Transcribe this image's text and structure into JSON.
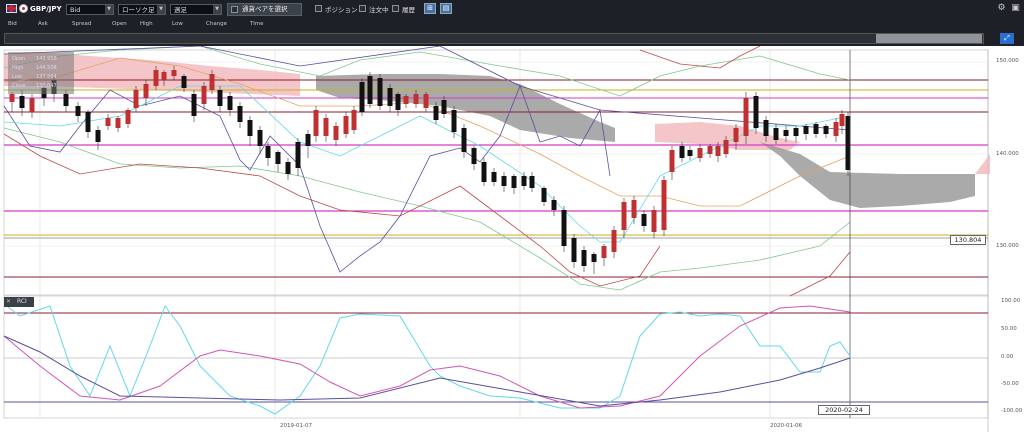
{
  "toolbar": {
    "symbol": "GBP/JPY",
    "price_type": "Bid",
    "chart_type": "ローソク足",
    "period": "週足",
    "select_pair_label": "通貨ペアを選択",
    "position_label": "ポジション",
    "orders_label": "注文中",
    "history_label": "履歴"
  },
  "legend": [
    "Bid",
    "Ask",
    "Spread",
    "Open",
    "High",
    "Low",
    "Change",
    "Time"
  ],
  "ohlc": {
    "open_label": "Open",
    "open_value": "143.958",
    "high_label": "High",
    "high_value": "144.508",
    "low_label": "Low",
    "low_value": "137.564",
    "close_label": "Close",
    "close_value": "138.047"
  },
  "price_axis": [
    "150.000",
    "140.000",
    "130.000"
  ],
  "current_price": "130.804",
  "rci": {
    "label": "RCI",
    "axis": [
      "100.00",
      "50.00",
      "0.00",
      "-50.00",
      "-100.00"
    ]
  },
  "dates": [
    "2019-01-07",
    "2020-01-06"
  ],
  "crosshair_date": "2020-02-24",
  "colors": {
    "toolbar_bg": "#1d2127",
    "bull_candle": "#c03030",
    "bear_candle": "#111111",
    "cloud_bull": "#f2b8bc",
    "cloud_bear": "#9b9b9b",
    "magenta_line": "#d23cc8",
    "maroon_line": "#8c1c2c",
    "gold_line": "#c9b21e",
    "rci_short": "#61d8e8",
    "rci_mid": "#d256b4",
    "rci_long": "#5a4f9e"
  },
  "icons": [
    "uk-flag-icon",
    "jp-flag-icon",
    "dropdown-arrow-icon",
    "checkbox-icon",
    "chart-tool-icon",
    "settings-gear-icon",
    "chart-layout-icon",
    "expand-icon",
    "close-panel-icon"
  ]
}
